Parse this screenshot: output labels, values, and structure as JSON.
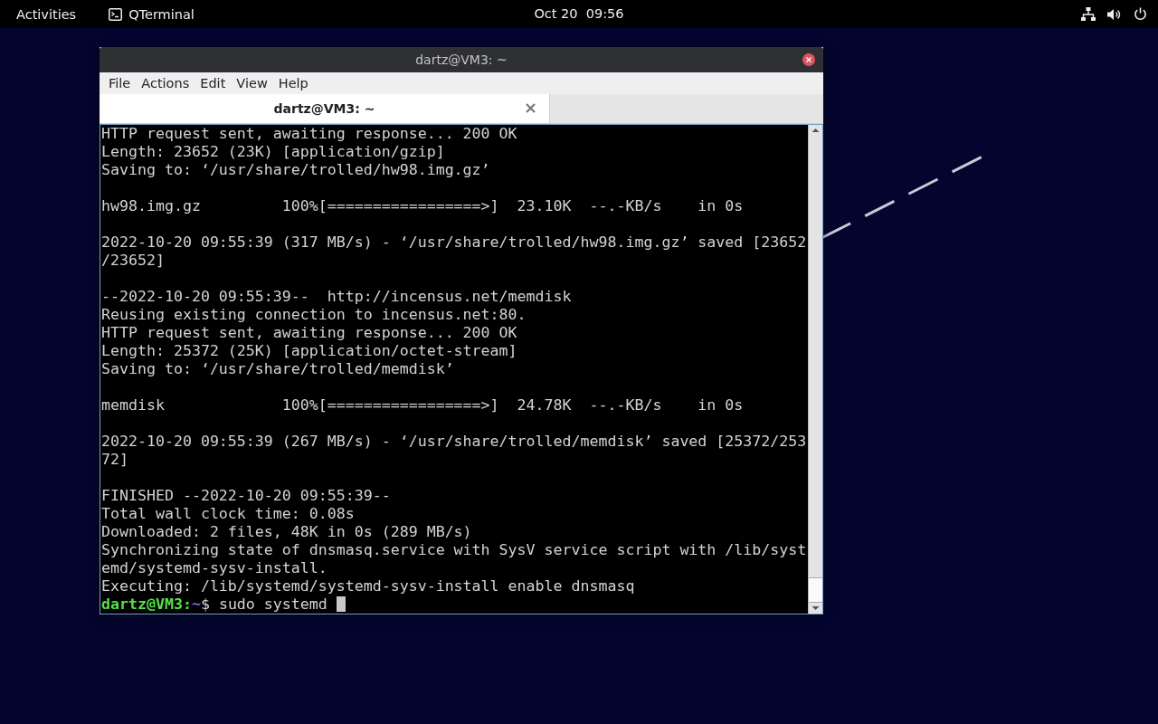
{
  "top_bar": {
    "activities": "Activities",
    "app": {
      "name": "QTerminal"
    },
    "clock": "Oct 20  09:56"
  },
  "window": {
    "title": "dartz@VM3: ~",
    "menu": [
      "File",
      "Actions",
      "Edit",
      "View",
      "Help"
    ],
    "tabs": [
      {
        "label": "dartz@VM3: ~",
        "selected": true
      }
    ],
    "terminal": {
      "lines": [
        {
          "kind": "output",
          "text": "HTTP request sent, awaiting response... 200 OK"
        },
        {
          "kind": "output",
          "text": "Length: 23652 (23K) [application/gzip]"
        },
        {
          "kind": "output",
          "text": "Saving to: ‘/usr/share/trolled/hw98.img.gz’"
        },
        {
          "kind": "blank"
        },
        {
          "kind": "output",
          "text": "hw98.img.gz         100%[=================>]  23.10K  --.-KB/s    in 0s"
        },
        {
          "kind": "blank"
        },
        {
          "kind": "output",
          "text": "2022-10-20 09:55:39 (317 MB/s) - ‘/usr/share/trolled/hw98.img.gz’ saved [23652"
        },
        {
          "kind": "output",
          "text": "/23652]"
        },
        {
          "kind": "blank"
        },
        {
          "kind": "output",
          "text": "--2022-10-20 09:55:39--  http://incensus.net/memdisk"
        },
        {
          "kind": "output",
          "text": "Reusing existing connection to incensus.net:80."
        },
        {
          "kind": "output",
          "text": "HTTP request sent, awaiting response... 200 OK"
        },
        {
          "kind": "output",
          "text": "Length: 25372 (25K) [application/octet-stream]"
        },
        {
          "kind": "output",
          "text": "Saving to: ‘/usr/share/trolled/memdisk’"
        },
        {
          "kind": "blank"
        },
        {
          "kind": "output",
          "text": "memdisk             100%[=================>]  24.78K  --.-KB/s    in 0s"
        },
        {
          "kind": "blank"
        },
        {
          "kind": "output",
          "text": "2022-10-20 09:55:39 (267 MB/s) - ‘/usr/share/trolled/memdisk’ saved [25372/253"
        },
        {
          "kind": "output",
          "text": "72]"
        },
        {
          "kind": "blank"
        },
        {
          "kind": "output",
          "text": "FINISHED --2022-10-20 09:55:39--"
        },
        {
          "kind": "output",
          "text": "Total wall clock time: 0.08s"
        },
        {
          "kind": "output",
          "text": "Downloaded: 2 files, 48K in 0s (289 MB/s)"
        },
        {
          "kind": "output",
          "text": "Synchronizing state of dnsmasq.service with SysV service script with /lib/syst"
        },
        {
          "kind": "output",
          "text": "emd/systemd-sysv-install."
        },
        {
          "kind": "output",
          "text": "Executing: /lib/systemd/systemd-sysv-install enable dnsmasq"
        },
        {
          "kind": "prompt",
          "user_host": "dartz@VM3",
          "separator": ":",
          "path": "~",
          "symbol": "$",
          "command": "sudo systemd"
        }
      ]
    }
  }
}
